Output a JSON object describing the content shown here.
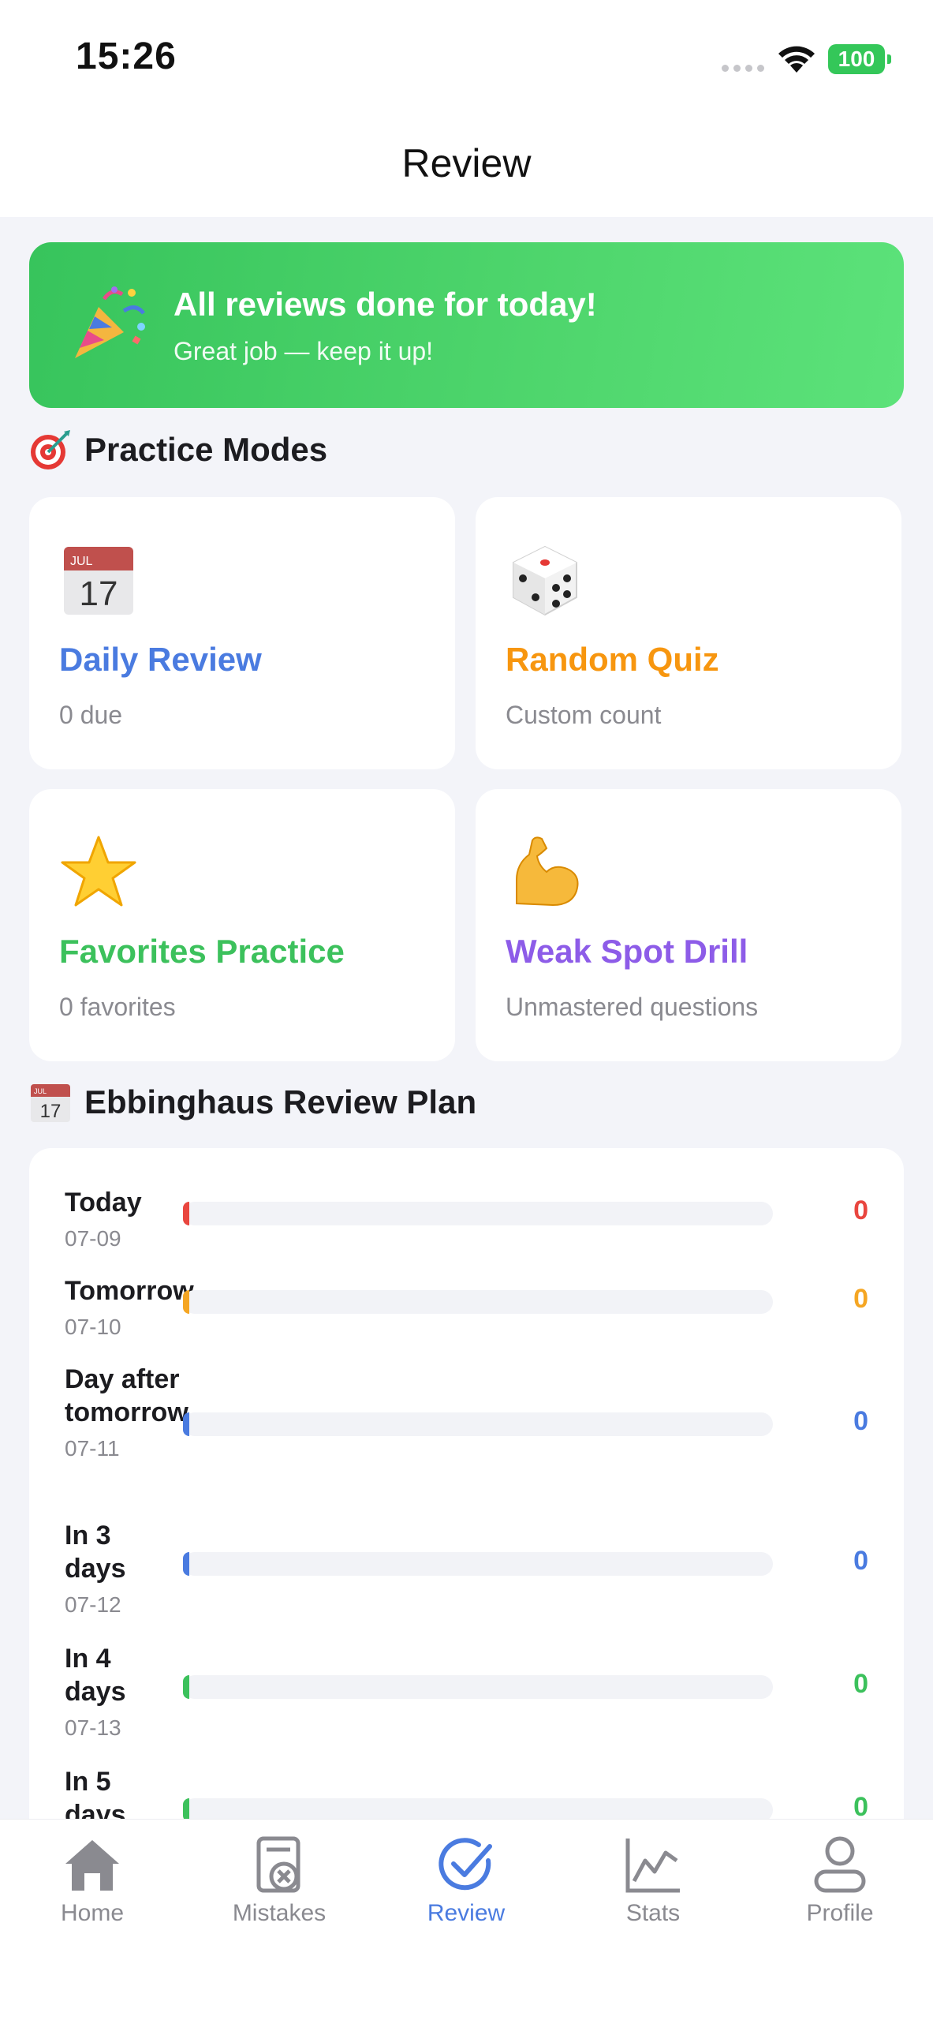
{
  "status_bar": {
    "time": "15:26",
    "battery": "100"
  },
  "nav": {
    "title": "Review"
  },
  "banner": {
    "title": "All reviews done for today!",
    "subtitle": "Great job — keep it up!",
    "icon": "party-popper-icon"
  },
  "practice": {
    "heading": "Practice Modes",
    "heading_icon": "dart-target-icon",
    "modes": [
      {
        "title": "Daily Review",
        "subtitle": "0 due",
        "icon": "calendar-icon",
        "color": "#4a7be0"
      },
      {
        "title": "Random Quiz",
        "subtitle": "Custom count",
        "icon": "dice-icon",
        "color": "#f7960f"
      },
      {
        "title": "Favorites Practice",
        "subtitle": "0 favorites",
        "icon": "star-icon",
        "color": "#3cc15c"
      },
      {
        "title": "Weak Spot Drill",
        "subtitle": "Unmastered questions",
        "icon": "flexed-biceps-icon",
        "color": "#8d5ce8"
      }
    ]
  },
  "plan": {
    "heading": "Ebbinghaus Review Plan",
    "heading_icon": "calendar-icon",
    "calendar_month": "JUL",
    "calendar_day": "17",
    "rows": [
      {
        "label": "Today",
        "date": "07-09",
        "count": "0",
        "color": "#e9463f",
        "progress": 0
      },
      {
        "label": "Tomorrow",
        "date": "07-10",
        "count": "0",
        "color": "#f5a623",
        "progress": 0
      },
      {
        "label": "Day after tomorrow",
        "date": "07-11",
        "count": "0",
        "color": "#4a7be0",
        "progress": 0
      },
      {
        "label": "In 3 days",
        "date": "07-12",
        "count": "0",
        "color": "#4a7be0",
        "progress": 0
      },
      {
        "label": "In 4 days",
        "date": "07-13",
        "count": "0",
        "color": "#3cc15c",
        "progress": 0
      },
      {
        "label": "In 5 days",
        "date": "",
        "count": "0",
        "color": "#3cc15c",
        "progress": 0
      }
    ]
  },
  "tabs": [
    {
      "label": "Home",
      "icon": "home-icon",
      "active": false
    },
    {
      "label": "Mistakes",
      "icon": "mistakes-icon",
      "active": false
    },
    {
      "label": "Review",
      "icon": "checkmark-circle-icon",
      "active": true
    },
    {
      "label": "Stats",
      "icon": "chart-icon",
      "active": false
    },
    {
      "label": "Profile",
      "icon": "person-icon",
      "active": false
    }
  ]
}
